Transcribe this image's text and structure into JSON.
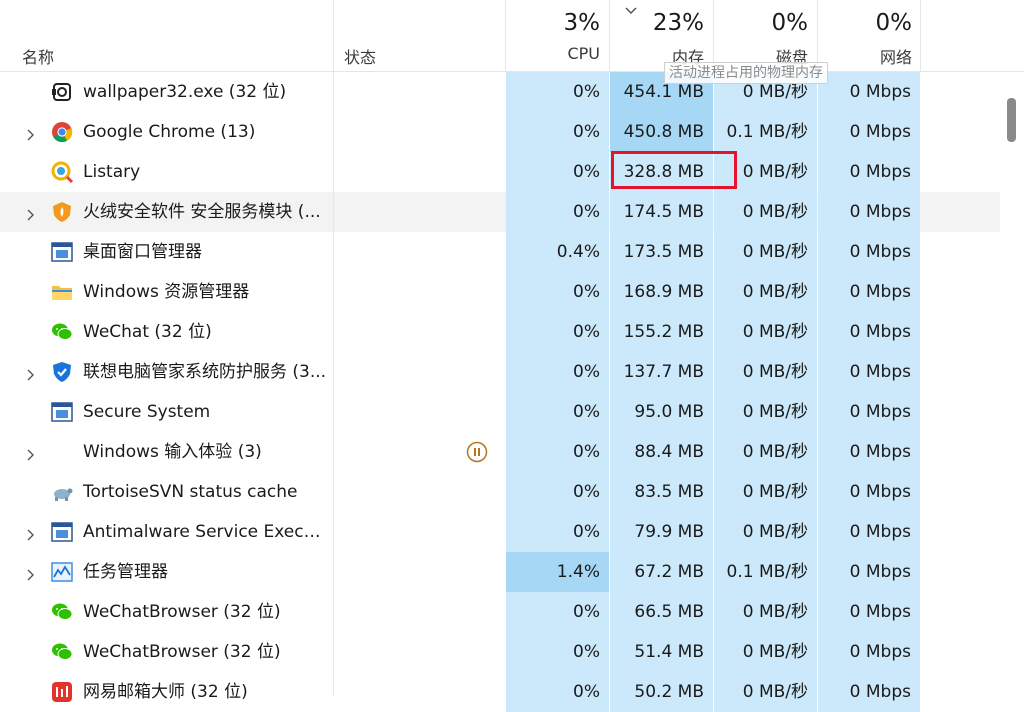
{
  "header": {
    "name_label": "名称",
    "status_label": "状态",
    "cpu": {
      "pct": "3%",
      "label": "CPU"
    },
    "mem": {
      "pct": "23%",
      "label": "内存"
    },
    "disk": {
      "pct": "0%",
      "label": "磁盘"
    },
    "net": {
      "pct": "0%",
      "label": "网络"
    },
    "tooltip": "活动进程占用的物理内存"
  },
  "colors": {
    "accent_light": "#cce9fb",
    "accent_strong": "#a6d8f6",
    "highlight_box": "#e5132b"
  },
  "rows": [
    {
      "name": "wallpaper32.exe (32 位)",
      "icon": "wallpaper-icon",
      "expand": false,
      "cpu": "0%",
      "mem": "454.1 MB",
      "disk": "0 MB/秒",
      "net": "0 Mbps"
    },
    {
      "name": "Google Chrome (13)",
      "icon": "chrome-icon",
      "expand": true,
      "cpu": "0%",
      "mem": "450.8 MB",
      "disk": "0.1 MB/秒",
      "net": "0 Mbps"
    },
    {
      "name": "Listary",
      "icon": "listary-icon",
      "expand": false,
      "cpu": "0%",
      "mem": "328.8 MB",
      "disk": "0 MB/秒",
      "net": "0 Mbps"
    },
    {
      "name": "火绒安全软件 安全服务模块 (...",
      "icon": "huorong-icon",
      "expand": true,
      "cpu": "0%",
      "mem": "174.5 MB",
      "disk": "0 MB/秒",
      "net": "0 Mbps"
    },
    {
      "name": "桌面窗口管理器",
      "icon": "window-icon",
      "expand": false,
      "cpu": "0.4%",
      "mem": "173.5 MB",
      "disk": "0 MB/秒",
      "net": "0 Mbps"
    },
    {
      "name": "Windows 资源管理器",
      "icon": "folder-icon",
      "expand": false,
      "cpu": "0%",
      "mem": "168.9 MB",
      "disk": "0 MB/秒",
      "net": "0 Mbps"
    },
    {
      "name": "WeChat (32 位)",
      "icon": "wechat-icon",
      "expand": false,
      "cpu": "0%",
      "mem": "155.2 MB",
      "disk": "0 MB/秒",
      "net": "0 Mbps"
    },
    {
      "name": "联想电脑管家系统防护服务 (3...",
      "icon": "shield-icon",
      "expand": true,
      "cpu": "0%",
      "mem": "137.7 MB",
      "disk": "0 MB/秒",
      "net": "0 Mbps"
    },
    {
      "name": "Secure System",
      "icon": "window-icon",
      "expand": false,
      "cpu": "0%",
      "mem": "95.0 MB",
      "disk": "0 MB/秒",
      "net": "0 Mbps"
    },
    {
      "name": "Windows 输入体验 (3)",
      "icon": "",
      "expand": true,
      "status": "pause-icon",
      "cpu": "0%",
      "mem": "88.4 MB",
      "disk": "0 MB/秒",
      "net": "0 Mbps"
    },
    {
      "name": "TortoiseSVN status cache",
      "icon": "tortoise-icon",
      "expand": false,
      "cpu": "0%",
      "mem": "83.5 MB",
      "disk": "0 MB/秒",
      "net": "0 Mbps"
    },
    {
      "name": "Antimalware Service Execut...",
      "icon": "window-icon",
      "expand": true,
      "cpu": "0%",
      "mem": "79.9 MB",
      "disk": "0 MB/秒",
      "net": "0 Mbps"
    },
    {
      "name": "任务管理器",
      "icon": "taskmgr-icon",
      "expand": true,
      "cpu": "1.4%",
      "mem": "67.2 MB",
      "disk": "0.1 MB/秒",
      "net": "0 Mbps"
    },
    {
      "name": "WeChatBrowser (32 位)",
      "icon": "wechat-icon",
      "expand": false,
      "cpu": "0%",
      "mem": "66.5 MB",
      "disk": "0 MB/秒",
      "net": "0 Mbps"
    },
    {
      "name": "WeChatBrowser (32 位)",
      "icon": "wechat-icon",
      "expand": false,
      "cpu": "0%",
      "mem": "51.4 MB",
      "disk": "0 MB/秒",
      "net": "0 Mbps"
    },
    {
      "name": "网易邮箱大师 (32 位)",
      "icon": "mail-icon",
      "expand": false,
      "cpu": "0%",
      "mem": "50.2 MB",
      "disk": "0 MB/秒",
      "net": "0 Mbps"
    }
  ]
}
